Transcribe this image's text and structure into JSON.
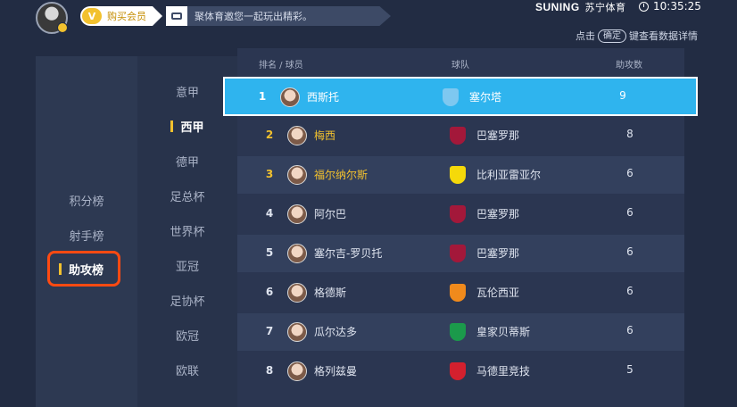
{
  "header": {
    "vip_badge": "V",
    "vip_label": "购买会员",
    "ticker_text": "聚体育邀您一起玩出精彩。",
    "brand_name": "SUNING",
    "brand_cn": "苏宁体育",
    "time": "10:35:25",
    "hint_prefix": "点击",
    "hint_key": "确定",
    "hint_suffix": "键查看数据详情"
  },
  "categories": [
    {
      "label": "积分榜"
    },
    {
      "label": "射手榜"
    },
    {
      "label": "助攻榜",
      "selected": true
    }
  ],
  "leagues": [
    {
      "label": "意甲"
    },
    {
      "label": "西甲",
      "active": true
    },
    {
      "label": "德甲"
    },
    {
      "label": "足总杯"
    },
    {
      "label": "世界杯"
    },
    {
      "label": "亚冠"
    },
    {
      "label": "足协杯"
    },
    {
      "label": "欧冠"
    },
    {
      "label": "欧联"
    }
  ],
  "table": {
    "col_rank_player": "排名 / 球员",
    "col_team": "球队",
    "col_assists": "助攻数",
    "rows": [
      {
        "rank": "1",
        "player": "西斯托",
        "team": "塞尔塔",
        "assists": "9",
        "crest_color": "#7ec8f0"
      },
      {
        "rank": "2",
        "player": "梅西",
        "team": "巴塞罗那",
        "assists": "8",
        "crest_color": "#a3183a"
      },
      {
        "rank": "3",
        "player": "福尔纳尔斯",
        "team": "比利亚雷亚尔",
        "assists": "6",
        "crest_color": "#f5d90a"
      },
      {
        "rank": "4",
        "player": "阿尔巴",
        "team": "巴塞罗那",
        "assists": "6",
        "crest_color": "#a3183a"
      },
      {
        "rank": "5",
        "player": "塞尔吉-罗贝托",
        "team": "巴塞罗那",
        "assists": "6",
        "crest_color": "#a3183a"
      },
      {
        "rank": "6",
        "player": "格德斯",
        "team": "瓦伦西亚",
        "assists": "6",
        "crest_color": "#f08a1c"
      },
      {
        "rank": "7",
        "player": "瓜尔达多",
        "team": "皇家贝蒂斯",
        "assists": "6",
        "crest_color": "#1b9a4b"
      },
      {
        "rank": "8",
        "player": "格列兹曼",
        "team": "马德里竞技",
        "assists": "5",
        "crest_color": "#d3202e"
      }
    ]
  }
}
